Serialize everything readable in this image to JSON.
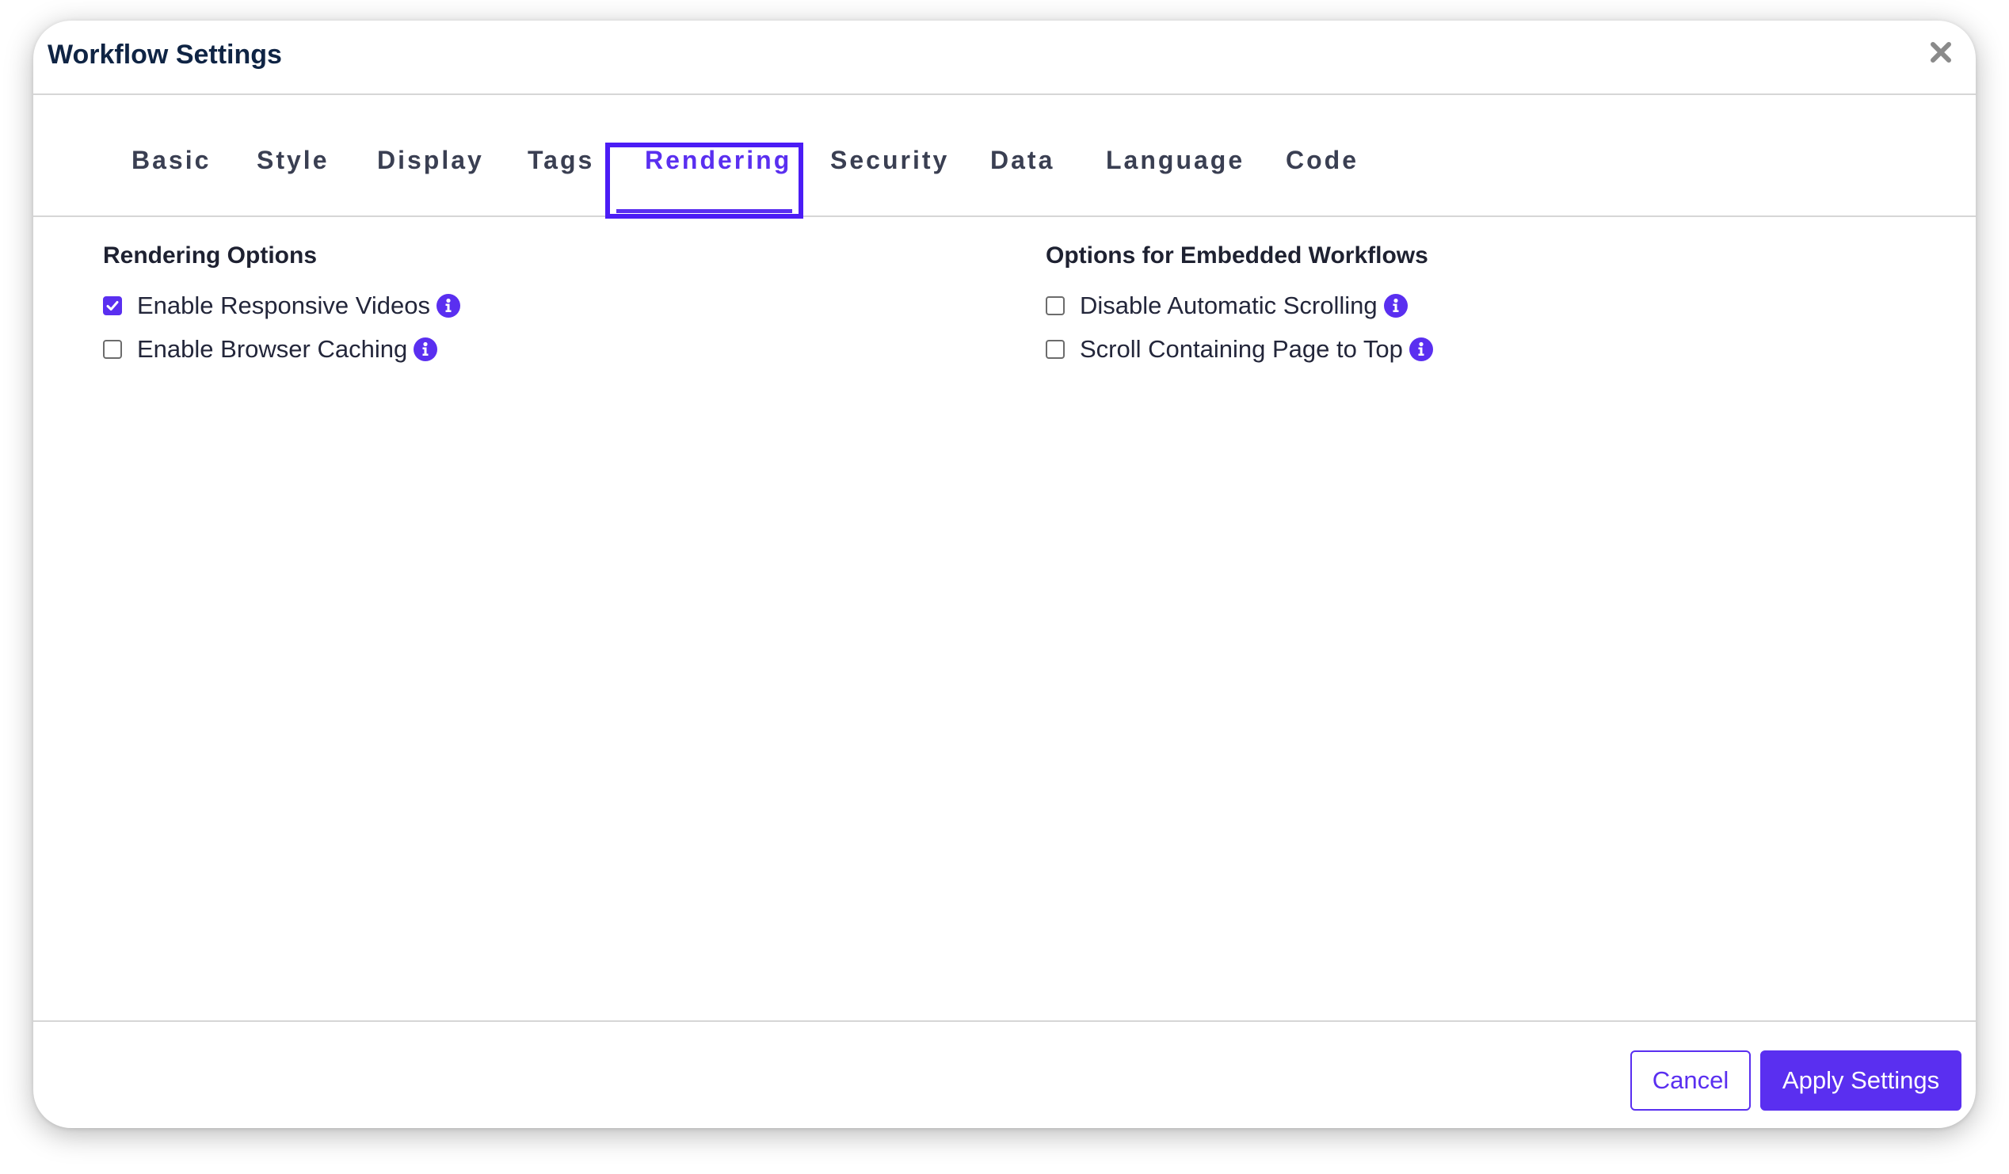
{
  "dialog": {
    "title": "Workflow Settings"
  },
  "tabs": [
    {
      "label": "Basic"
    },
    {
      "label": "Style"
    },
    {
      "label": "Display"
    },
    {
      "label": "Tags"
    },
    {
      "label": "Rendering",
      "active": true
    },
    {
      "label": "Security"
    },
    {
      "label": "Data"
    },
    {
      "label": "Language"
    },
    {
      "label": "Code"
    }
  ],
  "rendering_options": {
    "title": "Rendering Options",
    "items": [
      {
        "label": "Enable Responsive Videos",
        "checked": true
      },
      {
        "label": "Enable Browser Caching",
        "checked": false
      }
    ]
  },
  "embedded_options": {
    "title": "Options for Embedded Workflows",
    "items": [
      {
        "label": "Disable Automatic Scrolling",
        "checked": false
      },
      {
        "label": "Scroll Containing Page to Top",
        "checked": false
      }
    ]
  },
  "footer": {
    "cancel_label": "Cancel",
    "apply_label": "Apply Settings"
  },
  "colors": {
    "accent": "#5a2ff0",
    "focus_border": "#4b1cf5",
    "title_text": "#0f2444",
    "divider": "#d6d6d6"
  },
  "icons": {
    "close": "close-icon",
    "info": "info-icon",
    "check": "checkmark-icon"
  }
}
